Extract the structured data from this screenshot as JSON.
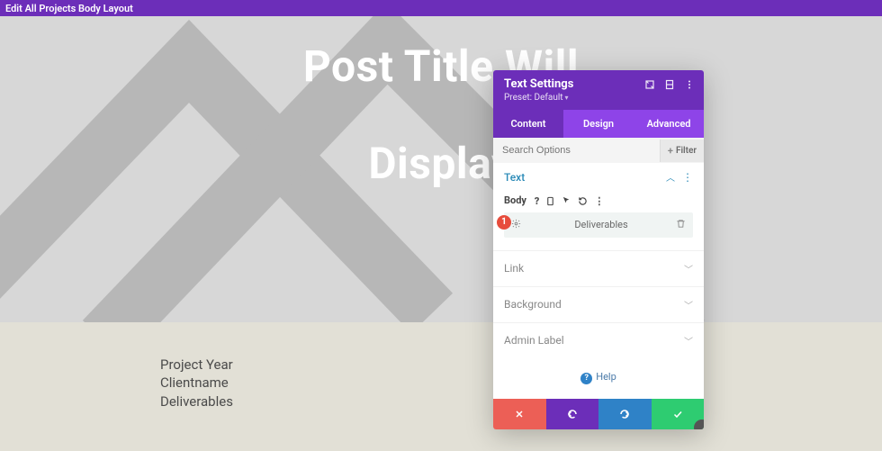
{
  "topbar": {
    "title": "Edit All Projects Body Layout"
  },
  "hero": {
    "line1": "Post Title Will",
    "line2": "Display "
  },
  "meta": {
    "project_year": "Project Year",
    "clientname": "Clientname",
    "deliverables": "Deliverables"
  },
  "panel": {
    "title": "Text Settings",
    "preset_label": "Preset: Default",
    "tabs": {
      "content": "Content",
      "design": "Design",
      "advanced": "Advanced"
    },
    "search_placeholder": "Search Options",
    "filter_label": "Filter",
    "section_text": "Text",
    "body_label": "Body",
    "body_value": "Deliverables",
    "groups": {
      "link": "Link",
      "background": "Background",
      "admin_label": "Admin Label"
    },
    "help_label": "Help",
    "step_badge": "1"
  }
}
